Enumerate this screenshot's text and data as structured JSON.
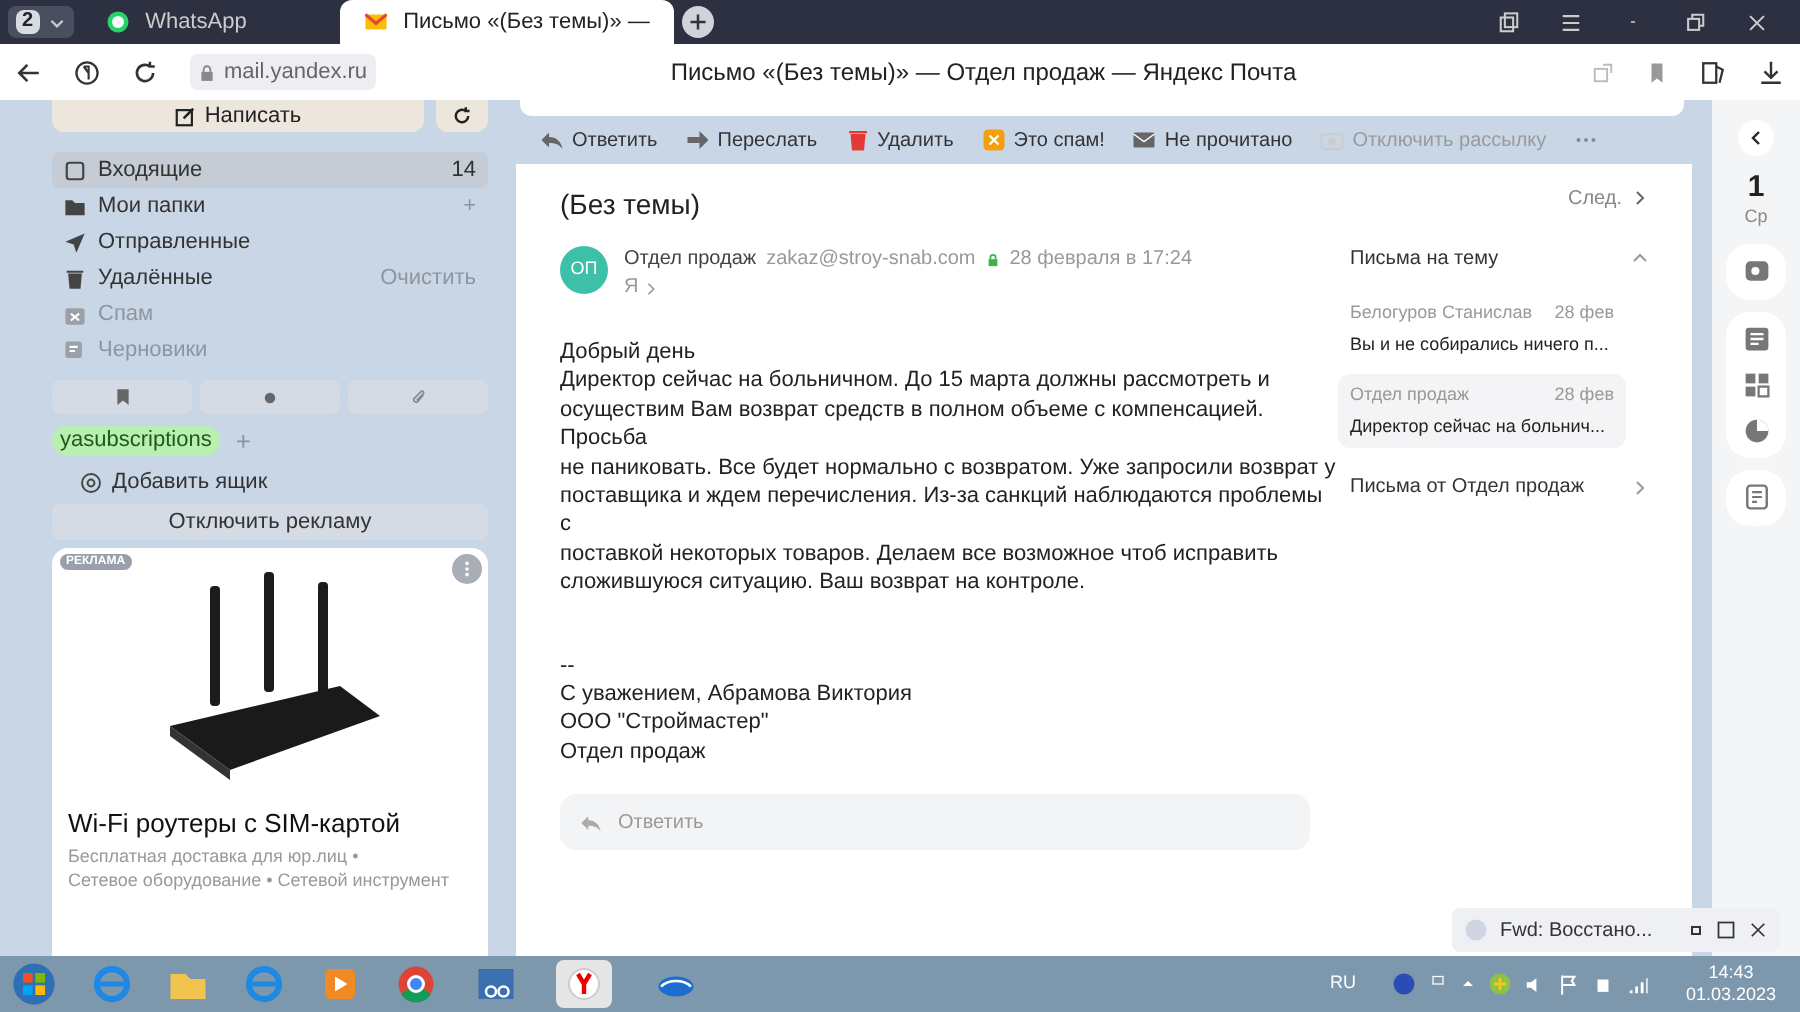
{
  "browser": {
    "tab_count": "2",
    "tabs": [
      {
        "title": "WhatsApp",
        "selected": false
      },
      {
        "title": "Письмо «(Без темы)» —",
        "selected": true
      }
    ],
    "url": "mail.yandex.ru",
    "page_title": "Письмо «(Без темы)» — Отдел продаж — Яндекс Почта"
  },
  "sidebar": {
    "compose": "Написать",
    "folders": [
      {
        "label": "Входящие",
        "badge": "14",
        "selected": true,
        "disabled": false
      },
      {
        "label": "Мои папки",
        "action": "+",
        "selected": false,
        "disabled": false
      },
      {
        "label": "Отправленные",
        "selected": false,
        "disabled": false
      },
      {
        "label": "Удалённые",
        "action": "Очистить",
        "selected": false,
        "disabled": false
      },
      {
        "label": "Спам",
        "selected": false,
        "disabled": true
      },
      {
        "label": "Черновики",
        "selected": false,
        "disabled": true
      }
    ],
    "tag": "yasubscriptions",
    "tag_add": "+",
    "add_mailbox": "Добавить ящик",
    "disable_ads": "Отключить рекламу",
    "ad": {
      "badge": "РЕКЛАМА",
      "title": "Wi-Fi роутеры с SIM-картой",
      "lines": [
        "Бесплатная доставка для юр.лиц •",
        "Сетевое оборудование • Сетевой инструмент"
      ]
    }
  },
  "toolbar": [
    {
      "label": "Ответить",
      "disabled": false
    },
    {
      "label": "Переслать",
      "disabled": false
    },
    {
      "label": "Удалить",
      "disabled": false
    },
    {
      "label": "Это спам!",
      "disabled": false
    },
    {
      "label": "Не прочитано",
      "disabled": false
    },
    {
      "label": "Отключить рассылку",
      "disabled": true
    }
  ],
  "message": {
    "subject": "(Без темы)",
    "next": "След.",
    "avatar": "ОП",
    "sender": "Отдел продаж",
    "email": "zakaz@stroy-snab.com",
    "date": "28 февраля в 17:24",
    "to": "Я",
    "body": [
      "Добрый день",
      "Директор сейчас на больничном. До 15 марта должны рассмотреть и",
      "осуществим Вам возврат средств в полном объеме с компенсацией.",
      "Просьба",
      "не паниковать. Все будет нормально с возвратом. Уже запросили возврат у",
      "поставщика и ждем перечисления. Из-за санкций наблюдаются проблемы",
      "с",
      "поставкой некоторых товаров. Делаем все возможное чтоб исправить",
      "сложившуюся ситуацию. Ваш возврат на контроле."
    ],
    "signature": [
      "--",
      "С уважением, Абрамова Виктория",
      "ООО \"Строймастер\"",
      "Отдел продаж"
    ],
    "reply_placeholder": "Ответить"
  },
  "thread": {
    "title": "Письма на тему",
    "expanded": true,
    "items": [
      {
        "sender": "Белогуров Станислав",
        "date": "28 фев",
        "preview": "Вы и не собирались ничего п...",
        "selected": false
      },
      {
        "sender": "Отдел продаж",
        "date": "28 фев",
        "preview": "Директор сейчас на больнич...",
        "selected": true
      }
    ],
    "from_sender": "Письма от Отдел продаж"
  },
  "rail": {
    "day": "1",
    "weekday": "Ср"
  },
  "notification": {
    "title": "Fwd: Восстано..."
  },
  "taskbar": {
    "language": "RU",
    "time": "14:43",
    "date": "01.03.2023"
  }
}
